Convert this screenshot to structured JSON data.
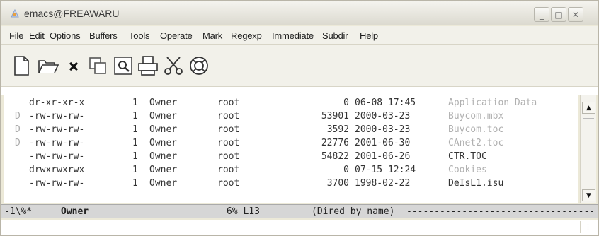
{
  "window": {
    "title": "emacs@FREAWARU",
    "controls": {
      "minimize": "_",
      "maximize": "□",
      "close": "✕"
    }
  },
  "menubar": {
    "items": [
      "File",
      "Edit",
      "Options",
      "Buffers",
      "Tools",
      "Operate",
      "Mark",
      "Regexp",
      "Immediate",
      "Subdir",
      "Help"
    ]
  },
  "toolbar": {
    "tools": [
      {
        "icon": "new-file-icon"
      },
      {
        "icon": "open-folder-icon"
      },
      {
        "icon": "close-x-icon"
      },
      {
        "icon": "copy-icon"
      },
      {
        "icon": "search-page-icon"
      },
      {
        "icon": "print-icon"
      },
      {
        "icon": "cut-scissors-icon"
      },
      {
        "icon": "help-lifebuoy-icon"
      }
    ]
  },
  "dired": {
    "rows": [
      {
        "mark": "",
        "perms": "dr-xr-xr-x",
        "links": "1",
        "owner": "Owner",
        "group": "root",
        "size": "0",
        "date": "06-08 17:45",
        "name": "Application Data"
      },
      {
        "mark": "D",
        "perms": "-rw-rw-rw-",
        "links": "1",
        "owner": "Owner",
        "group": "root",
        "size": "53901",
        "date": "2000-03-23",
        "name": "Buycom.mbx"
      },
      {
        "mark": "D",
        "perms": "-rw-rw-rw-",
        "links": "1",
        "owner": "Owner",
        "group": "root",
        "size": "3592",
        "date": "2000-03-23",
        "name": "Buycom.toc"
      },
      {
        "mark": "D",
        "perms": "-rw-rw-rw-",
        "links": "1",
        "owner": "Owner",
        "group": "root",
        "size": "22776",
        "date": "2001-06-30",
        "name": "CAnet2.toc"
      },
      {
        "mark": "",
        "perms": "-rw-rw-rw-",
        "links": "1",
        "owner": "Owner",
        "group": "root",
        "size": "54822",
        "date": "2001-06-26",
        "name": "CTR.TOC"
      },
      {
        "mark": "",
        "perms": "drwxrwxrwx",
        "links": "1",
        "owner": "Owner",
        "group": "root",
        "size": "0",
        "date": "07-15 12:24",
        "name": "Cookies"
      },
      {
        "mark": "",
        "perms": "-rw-rw-rw-",
        "links": "1",
        "owner": "Owner",
        "group": "root",
        "size": "3700",
        "date": "1998-02-22",
        "name": "DeIsL1.isu"
      }
    ]
  },
  "modeline": {
    "status": "-1\\%*",
    "buffer": "Owner",
    "position": "6% L13",
    "mode": "(Dired by name)",
    "fill": "-----------------------------------"
  },
  "scrollbar": {
    "up": "▲",
    "down": "▼"
  }
}
